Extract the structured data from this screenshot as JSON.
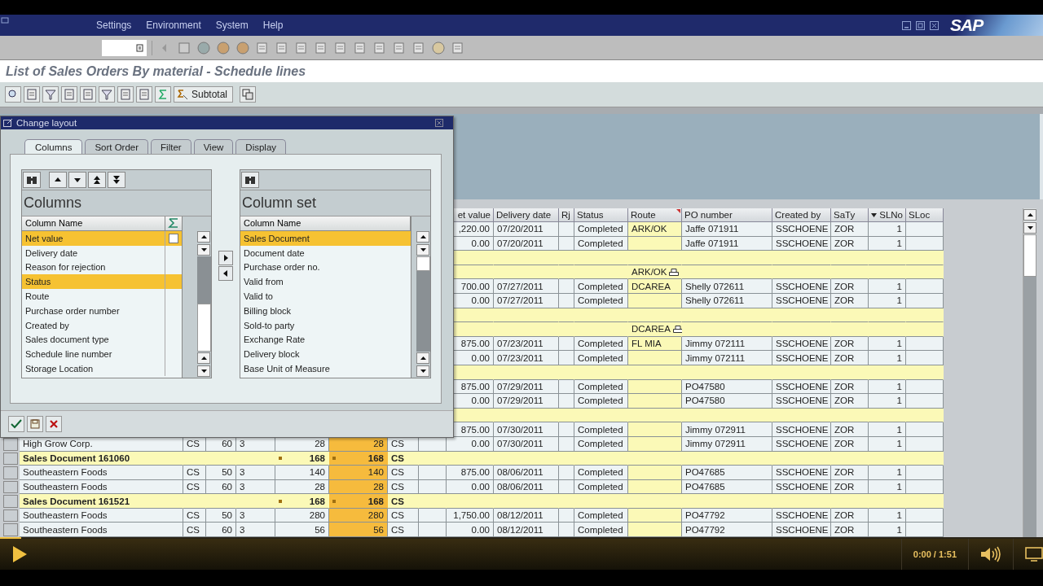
{
  "menu": [
    {
      "label": "Settings"
    },
    {
      "label": "Environment"
    },
    {
      "label": "System"
    },
    {
      "label": "Help"
    }
  ],
  "logo": "SAP",
  "title": "List of Sales Orders By material - Schedule lines",
  "app_toolbar": {
    "subtotal_label": "Subtotal"
  },
  "grid": {
    "columns": [
      {
        "label": "et value",
        "sorted": false,
        "subtotal": false
      },
      {
        "label": "Delivery date",
        "sorted": false,
        "subtotal": false
      },
      {
        "label": "Rj",
        "sorted": false,
        "subtotal": false
      },
      {
        "label": "Status",
        "sorted": false,
        "subtotal": false
      },
      {
        "label": "Route",
        "sorted": false,
        "subtotal": true
      },
      {
        "label": "PO number",
        "sorted": false,
        "subtotal": false
      },
      {
        "label": "Created by",
        "sorted": false,
        "subtotal": false
      },
      {
        "label": "SaTy",
        "sorted": false,
        "subtotal": false
      },
      {
        "label": "SLNo",
        "sorted": true,
        "subtotal": false
      },
      {
        "label": "SLoc",
        "sorted": false,
        "subtotal": false
      }
    ],
    "rows": [
      {
        "kind": "item",
        "cells": {
          "net_value": ",220.00",
          "delivery_date": "07/20/2011",
          "status": "Completed",
          "route": "ARK/OK",
          "po_number": "Jaffe 071911",
          "created_by": "SSCHOENE",
          "saty": "ZOR",
          "slno": "1"
        }
      },
      {
        "kind": "item",
        "cells": {
          "net_value": "0.00",
          "delivery_date": "07/20/2011",
          "status": "Completed",
          "po_number": "Jaffe 071911",
          "created_by": "SSCHOENE",
          "saty": "ZOR",
          "slno": "1"
        }
      },
      {
        "kind": "spacer",
        "cells": {}
      },
      {
        "kind": "route_total",
        "cells": {
          "route": "ARK/OK"
        }
      },
      {
        "kind": "item",
        "cells": {
          "net_value": "700.00",
          "delivery_date": "07/27/2011",
          "status": "Completed",
          "route": "DCAREA",
          "po_number": "Shelly 072611",
          "created_by": "SSCHOENE",
          "saty": "ZOR",
          "slno": "1"
        }
      },
      {
        "kind": "item",
        "cells": {
          "net_value": "0.00",
          "delivery_date": "07/27/2011",
          "status": "Completed",
          "po_number": "Shelly 072611",
          "created_by": "SSCHOENE",
          "saty": "ZOR",
          "slno": "1"
        }
      },
      {
        "kind": "spacer",
        "cells": {}
      },
      {
        "kind": "route_total",
        "cells": {
          "route": "DCAREA"
        }
      },
      {
        "kind": "item",
        "cells": {
          "net_value": "875.00",
          "delivery_date": "07/23/2011",
          "status": "Completed",
          "route": "FL MIA",
          "po_number": "Jimmy 072111",
          "created_by": "SSCHOENE",
          "saty": "ZOR",
          "slno": "1"
        }
      },
      {
        "kind": "item",
        "cells": {
          "net_value": "0.00",
          "delivery_date": "07/23/2011",
          "status": "Completed",
          "po_number": "Jimmy 072111",
          "created_by": "SSCHOENE",
          "saty": "ZOR",
          "slno": "1"
        }
      },
      {
        "kind": "spacer",
        "cells": {}
      },
      {
        "kind": "item",
        "cells": {
          "net_value": "875.00",
          "delivery_date": "07/29/2011",
          "status": "Completed",
          "po_number": "PO47580",
          "created_by": "SSCHOENE",
          "saty": "ZOR",
          "slno": "1"
        }
      },
      {
        "kind": "item",
        "cells": {
          "net_value": "0.00",
          "delivery_date": "07/29/2011",
          "status": "Completed",
          "po_number": "PO47580",
          "created_by": "SSCHOENE",
          "saty": "ZOR",
          "slno": "1"
        }
      },
      {
        "kind": "spacer",
        "cells": {}
      },
      {
        "kind": "item",
        "cells": {
          "net_value": "875.00",
          "delivery_date": "07/30/2011",
          "status": "Completed",
          "po_number": "Jimmy 072911",
          "created_by": "SSCHOENE",
          "saty": "ZOR",
          "slno": "1"
        }
      },
      {
        "kind": "item",
        "cells": {
          "customer": "High Grow Corp.",
          "unit": "CS",
          "column_3": "60",
          "column_4": "3",
          "quantity": "28",
          "confirmed_quantity": "28",
          "unit_2": "CS",
          "net_value": "0.00",
          "delivery_date": "07/30/2011",
          "status": "Completed",
          "po_number": "Jimmy 072911",
          "created_by": "SSCHOENE",
          "saty": "ZOR",
          "slno": "1"
        }
      },
      {
        "kind": "doc_total",
        "cells": {
          "customer": "Sales Document 161060",
          "quantity": "168",
          "confirmed_quantity": "168",
          "unit_2": "CS"
        }
      },
      {
        "kind": "item",
        "cells": {
          "customer": "Southeastern Foods",
          "unit": "CS",
          "column_3": "50",
          "column_4": "3",
          "quantity": "140",
          "confirmed_quantity": "140",
          "unit_2": "CS",
          "net_value": "875.00",
          "delivery_date": "08/06/2011",
          "status": "Completed",
          "po_number": "PO47685",
          "created_by": "SSCHOENE",
          "saty": "ZOR",
          "slno": "1"
        }
      },
      {
        "kind": "item",
        "cells": {
          "customer": "Southeastern Foods",
          "unit": "CS",
          "column_3": "60",
          "column_4": "3",
          "quantity": "28",
          "confirmed_quantity": "28",
          "unit_2": "CS",
          "net_value": "0.00",
          "delivery_date": "08/06/2011",
          "status": "Completed",
          "po_number": "PO47685",
          "created_by": "SSCHOENE",
          "saty": "ZOR",
          "slno": "1"
        }
      },
      {
        "kind": "doc_total",
        "cells": {
          "customer": "Sales Document 161521",
          "quantity": "168",
          "confirmed_quantity": "168",
          "unit_2": "CS"
        }
      },
      {
        "kind": "item",
        "cells": {
          "customer": "Southeastern Foods",
          "unit": "CS",
          "column_3": "50",
          "column_4": "3",
          "quantity": "280",
          "confirmed_quantity": "280",
          "unit_2": "CS",
          "net_value": "1,750.00",
          "delivery_date": "08/12/2011",
          "status": "Completed",
          "po_number": "PO47792",
          "created_by": "SSCHOENE",
          "saty": "ZOR",
          "slno": "1"
        }
      },
      {
        "kind": "item",
        "cells": {
          "customer": "Southeastern Foods",
          "unit": "CS",
          "column_3": "60",
          "column_4": "3",
          "quantity": "56",
          "confirmed_quantity": "56",
          "unit_2": "CS",
          "net_value": "0.00",
          "delivery_date": "08/12/2011",
          "status": "Completed",
          "po_number": "PO47792",
          "created_by": "SSCHOENE",
          "saty": "ZOR",
          "slno": "1"
        }
      }
    ]
  },
  "dialog": {
    "title": "Change layout",
    "tabs": [
      {
        "label": "Columns",
        "selected": true
      },
      {
        "label": "Sort Order",
        "selected": false
      },
      {
        "label": "Filter",
        "selected": false
      },
      {
        "label": "View",
        "selected": false
      },
      {
        "label": "Display",
        "selected": false
      }
    ],
    "columns_panel": {
      "title": "Columns",
      "header": "Column Name",
      "rows": [
        {
          "label": "Net value",
          "selected": true
        },
        {
          "label": "Delivery date",
          "selected": false
        },
        {
          "label": "Reason for rejection",
          "selected": false
        },
        {
          "label": "Status",
          "selected": true
        },
        {
          "label": "Route",
          "selected": false
        },
        {
          "label": "Purchase order number",
          "selected": false
        },
        {
          "label": "Created by",
          "selected": false
        },
        {
          "label": "Sales document type",
          "selected": false
        },
        {
          "label": "Schedule line number",
          "selected": false
        },
        {
          "label": "Storage Location",
          "selected": false
        }
      ],
      "sum_checked": false
    },
    "column_set_panel": {
      "title": "Column set",
      "header": "Column Name",
      "rows": [
        {
          "label": "Sales Document",
          "selected": true
        },
        {
          "label": "Document date",
          "selected": false
        },
        {
          "label": "Purchase order no.",
          "selected": false
        },
        {
          "label": "Valid from",
          "selected": false
        },
        {
          "label": "Valid to",
          "selected": false
        },
        {
          "label": "Billing block",
          "selected": false
        },
        {
          "label": "Sold-to party",
          "selected": false
        },
        {
          "label": "Exchange Rate",
          "selected": false
        },
        {
          "label": "Delivery block",
          "selected": false
        },
        {
          "label": "Base Unit of Measure",
          "selected": false
        }
      ]
    }
  },
  "player": {
    "time": "0:00 / 1:51",
    "level": 0.02
  }
}
